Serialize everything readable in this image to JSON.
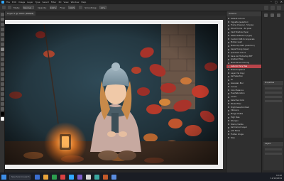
{
  "app": {
    "menus": [
      "File",
      "Edit",
      "Image",
      "Layer",
      "Type",
      "Select",
      "Filter",
      "3D",
      "View",
      "Window",
      "Help"
    ],
    "window_controls": [
      "–",
      "□",
      "✕"
    ]
  },
  "options_bar": {
    "mode_label": "Mode:",
    "mode_value": "Normal",
    "opacity_label": "Opacity:",
    "opacity_value": "100%",
    "flow_label": "Flow:",
    "flow_value": "100%",
    "smoothing_label": "Smoothing:",
    "smoothing_value": "10%"
  },
  "document": {
    "tab_label": "Layer 0 @ 100% (RGB/8)",
    "status": "100%   Doc: 20.6M/41.2M"
  },
  "actions_panel": {
    "title": "Actions",
    "items": [
      "Default Actions",
      "Vignette (selection)",
      "Frame Channel - 50 pixel",
      "Wood Frame - 50 pixel",
      "Cast Shadow (type)",
      "Water Reflection (type)",
      "Custom RGB to Grayscale",
      "Molten Lead",
      "Make Clip Path (selection)",
      "Sepia Toning (layer)",
      "Quadrant Colors",
      "Save As Photoshop PDF",
      "Gradient Map",
      "Mixer Brush Cloning",
      "Autumn Fairy Tale",
      "Make Snapshot",
      "Layer Via Copy",
      "Set Selection",
      "Fill",
      "Gaussian Blur",
      "Curves",
      "Color Balance",
      "Hue/Saturation",
      "Levels",
      "Selective Color",
      "Photo Filter",
      "Brightness/Contrast",
      "Vibrance",
      "Merge Visible",
      "High Pass",
      "Sharpen",
      "Stamp Visible",
      "Set Current Layer",
      "Add Noise",
      "Flatten Image",
      "Stop"
    ],
    "selected_index": 14
  },
  "right_dock": {
    "panel_title": "Properties",
    "panel2_title": "Layers"
  },
  "taskbar": {
    "search_placeholder": "Type here to search",
    "time": "10:42",
    "date": "11/14/2019",
    "app_colors": [
      "#3b6fd1",
      "#e8a33a",
      "#2d9e4f",
      "#d94141",
      "#31a8ff",
      "#7a5cc8",
      "#d6d6d6",
      "#3aa7a0",
      "#c45a2a",
      "#5a8de0"
    ]
  },
  "colors": {
    "accent_selected": "#b8444a",
    "ps_blue": "#31a8ff"
  }
}
